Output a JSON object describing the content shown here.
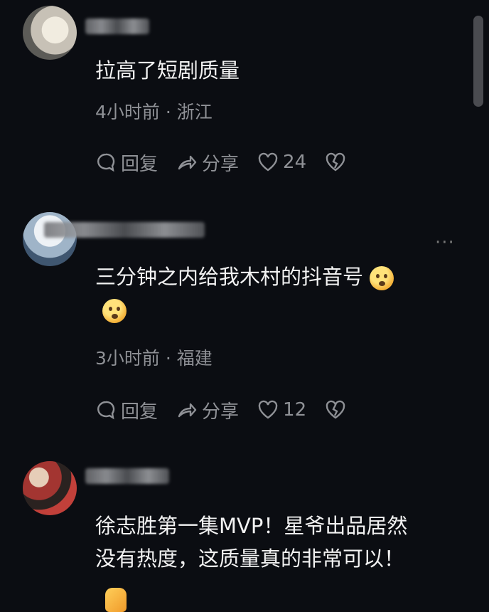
{
  "comments": [
    {
      "text": "拉高了短剧质量",
      "time_location": "4小时前 · 浙江",
      "reply_label": "回复",
      "share_label": "分享",
      "likes": "24"
    },
    {
      "text": "三分钟之内给我木村的抖音号",
      "time_location": "3小时前 · 福建",
      "reply_label": "回复",
      "share_label": "分享",
      "likes": "12",
      "more_label": "···"
    },
    {
      "text_line1": "徐志胜第一集MVP！星爷出品居然",
      "text_line2": "没有热度，这质量真的非常可以！"
    }
  ],
  "icons": {
    "reply": "comment-bubble-icon",
    "share": "share-arrow-icon",
    "like": "heart-icon",
    "dislike": "broken-heart-icon",
    "emoji": "shushing-face-emoji",
    "thumb": "thumbs-up-emoji"
  }
}
